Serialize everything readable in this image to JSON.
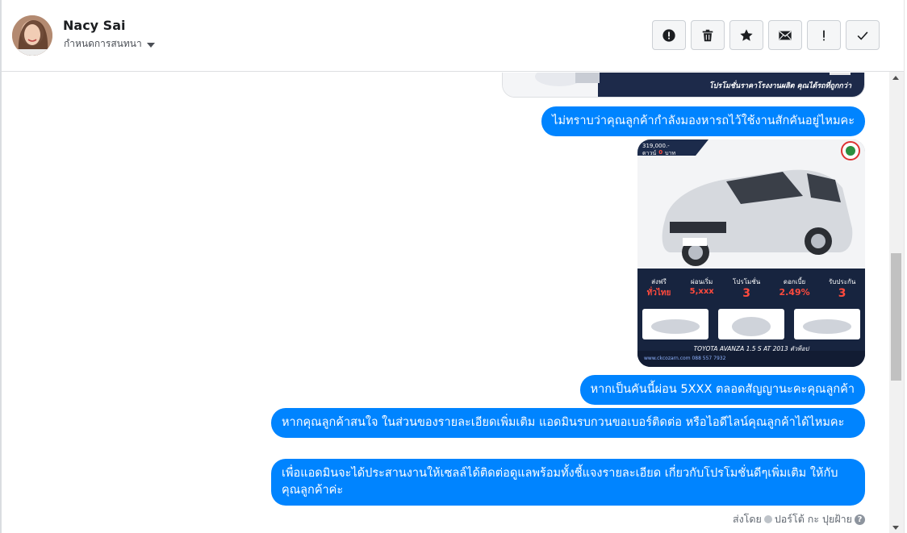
{
  "header": {
    "name": "Nacy Sai",
    "subtitle": "กำหนดการสนทนา",
    "toolbar": [
      {
        "name": "mark-spam-button",
        "icon": "alert-circle-icon"
      },
      {
        "name": "delete-button",
        "icon": "trash-icon"
      },
      {
        "name": "star-button",
        "icon": "star-icon"
      },
      {
        "name": "mark-unread-button",
        "icon": "envelope-icon"
      },
      {
        "name": "follow-up-button",
        "icon": "exclamation-icon"
      },
      {
        "name": "mark-done-button",
        "icon": "check-icon"
      }
    ]
  },
  "top_image": {
    "caption": "โปรโมชั่นราคาโรงงานผลิต คุณได้รถที่ถูกกว่า"
  },
  "messages": [
    {
      "text": "ไม่ทราบว่าคุณลูกค้ากำลังมองหารถไว้ใช้งานสักคันอยู่ไหมคะ"
    },
    {
      "text": "หากเป็นคันนี้ผ่อน 5XXX ตลอดสัญญานะคะคุณลูกค้า"
    },
    {
      "text": "หากคุณลูกค้าสนใจ ในส่วนของรายละเอียดเพิ่มเติม แอดมินรบกวนขอเบอร์ติดต่อ หรือไอดีไลน์คุณลูกค้าได้ไหมคะ"
    },
    {
      "text": "เพื่อแอดมินจะได้ประสานงานให้เซลล์ได้ติดต่อดูแลพร้อมทั้งชี้แจงรายละเอียด เกี่ยวกับโปรโมชั่นดีๆเพิ่มเติม ให้กับคุณลูกค้าค่ะ"
    }
  ],
  "car_ad": {
    "price_top": "319,000.-",
    "down_label": "ดาวน์",
    "down_value": "0",
    "down_unit": "บาท",
    "items": [
      {
        "label": "ส่งฟรี",
        "value": "ทั่วไทย"
      },
      {
        "label": "ผ่อนเริ่ม",
        "value": "5,xxx"
      },
      {
        "label": "โปรโมชั่น",
        "value": "3"
      },
      {
        "label": "ดอกเบี้ย",
        "value": "2.49%"
      },
      {
        "label": "รับประกัน",
        "value": "3"
      }
    ],
    "model": "TOYOTA AVANZA 1.5 S AT 2013 ตัวท็อป",
    "contact": "www.ckcozarn.com 088 557 7932"
  },
  "footer": {
    "sent_by": "ส่งโดย",
    "agent": "ปอร์โต้ กะ ปุยฝ้าย",
    "help": "?"
  },
  "colors": {
    "bubble": "#0084ff",
    "header_border": "#dddfe2"
  }
}
